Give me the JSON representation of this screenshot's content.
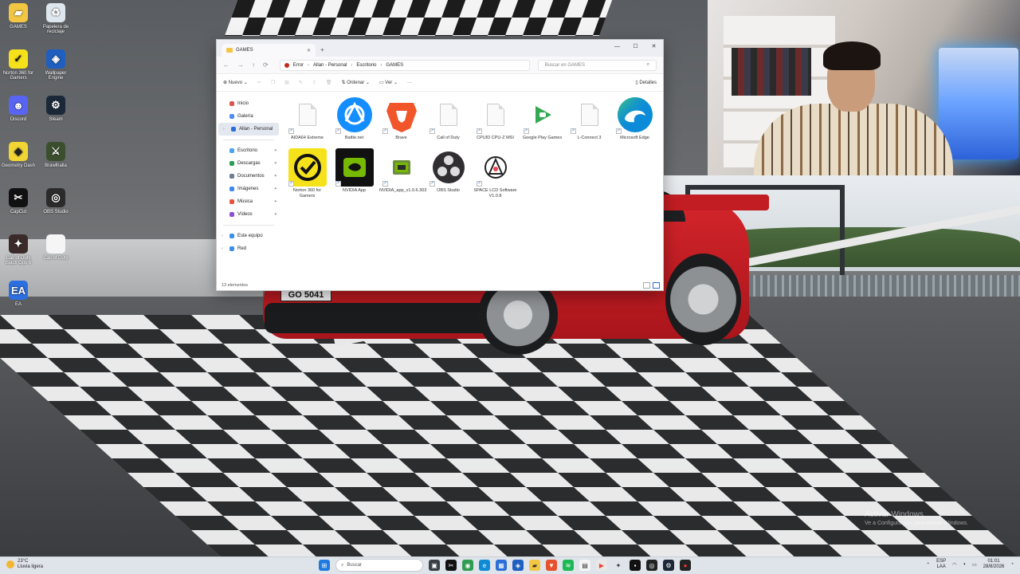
{
  "wallpaper": {
    "plate_text": "GO 5041"
  },
  "desktop_icons": [
    {
      "label": "GAMES",
      "icon": "folder-icon",
      "color": "#f2c643"
    },
    {
      "label": "Papelera de reciclaje",
      "icon": "recycle-bin-icon",
      "color": "#dfe7ee"
    },
    {
      "label": "Norton 360 for Gamers",
      "icon": "norton-icon",
      "color": "#f6e21b"
    },
    {
      "label": "Wallpaper Engine",
      "icon": "wallpaper-engine-icon",
      "color": "#1f5fbf"
    },
    {
      "label": "Discord",
      "icon": "discord-icon",
      "color": "#5865f2"
    },
    {
      "label": "Steam",
      "icon": "steam-icon",
      "color": "#1b2838"
    },
    {
      "label": "Geometry Dash",
      "icon": "geometry-dash-icon",
      "color": "#f1d534"
    },
    {
      "label": "Brawlhalla",
      "icon": "brawlhalla-icon",
      "color": "#3b4f2e"
    },
    {
      "label": "CapCut",
      "icon": "capcut-icon",
      "color": "#111111"
    },
    {
      "label": "OBS Studio",
      "icon": "obs-icon",
      "color": "#2b2b2b"
    },
    {
      "label": "Call of Duty Black Ops 6",
      "icon": "call-of-duty-icon",
      "color": "#3a2a2a"
    },
    {
      "label": "Call of Duty",
      "icon": "file-icon",
      "color": "#f5f5f5"
    },
    {
      "label": "EA",
      "icon": "ea-icon",
      "color": "#2b6fe0"
    }
  ],
  "explorer": {
    "tab_title": "GAMES",
    "window_controls": [
      "—",
      "☐",
      "✕"
    ],
    "nav_icons": [
      "←",
      "→",
      "↑",
      "⟳"
    ],
    "breadcrumb": [
      "Error",
      "Allan - Personal",
      "Escritorio",
      "GAMES"
    ],
    "search_placeholder": "Buscar en GAMES",
    "toolbar": {
      "new": "Nuevo",
      "sort": "Ordenar",
      "view": "Ver",
      "more": "···",
      "details": "Detalles"
    },
    "sidebar": [
      {
        "label": "Inicio",
        "icon": "home-icon",
        "color": "#d9534f"
      },
      {
        "label": "Galería",
        "icon": "gallery-icon",
        "color": "#4c8bf5"
      },
      {
        "label": "Allan - Personal",
        "icon": "cloud-icon",
        "color": "#2b6fd6",
        "active": true
      },
      {
        "label": "Escritorio",
        "icon": "desktop-icon",
        "color": "#4aa3f0",
        "pinned": true
      },
      {
        "label": "Descargas",
        "icon": "downloads-icon",
        "color": "#2d9c5a",
        "pinned": true
      },
      {
        "label": "Documentos",
        "icon": "documents-icon",
        "color": "#6b7c93",
        "pinned": true
      },
      {
        "label": "Imágenes",
        "icon": "pictures-icon",
        "color": "#3c8be8",
        "pinned": true
      },
      {
        "label": "Música",
        "icon": "music-icon",
        "color": "#e8533c",
        "pinned": true
      },
      {
        "label": "Vídeos",
        "icon": "videos-icon",
        "color": "#8c4fd6",
        "pinned": true
      },
      {
        "label": "Este equipo",
        "icon": "this-pc-icon",
        "color": "#3a8ee6"
      },
      {
        "label": "Red",
        "icon": "network-icon",
        "color": "#3a8ee6"
      }
    ],
    "files": [
      {
        "label": "AIDA64 Extreme",
        "icon": "generic-file-icon"
      },
      {
        "label": "Battle.net",
        "icon": "battlenet-icon"
      },
      {
        "label": "Brave",
        "icon": "brave-icon"
      },
      {
        "label": "Call of Duty",
        "icon": "generic-file-icon"
      },
      {
        "label": "CPUID CPU-Z MSI",
        "icon": "generic-file-icon"
      },
      {
        "label": "Google Play Games",
        "icon": "google-play-games-icon"
      },
      {
        "label": "L-Connect 3",
        "icon": "generic-file-icon"
      },
      {
        "label": "Microsoft Edge",
        "icon": "edge-icon"
      },
      {
        "label": "Norton 360 for Gamers",
        "icon": "norton-icon"
      },
      {
        "label": "NVIDIA App",
        "icon": "nvidia-icon"
      },
      {
        "label": "NVIDIA_app_v1.0.6.303",
        "icon": "nvidia-installer-icon"
      },
      {
        "label": "OBS Studio",
        "icon": "obs-icon"
      },
      {
        "label": "SPACE LCD Software V1.0.8",
        "icon": "space-lcd-icon"
      }
    ],
    "status": "13 elementos"
  },
  "watermark": {
    "line1": "Activar Windows",
    "line2": "Ve a Configuración para activar Windows."
  },
  "taskbar": {
    "temperature": "23°C",
    "weather": "Lluvia ligera",
    "search_placeholder": "Buscar",
    "lang1": "ESP",
    "lang2": "LAA",
    "time": "01:01",
    "date": "28/8/2026"
  }
}
